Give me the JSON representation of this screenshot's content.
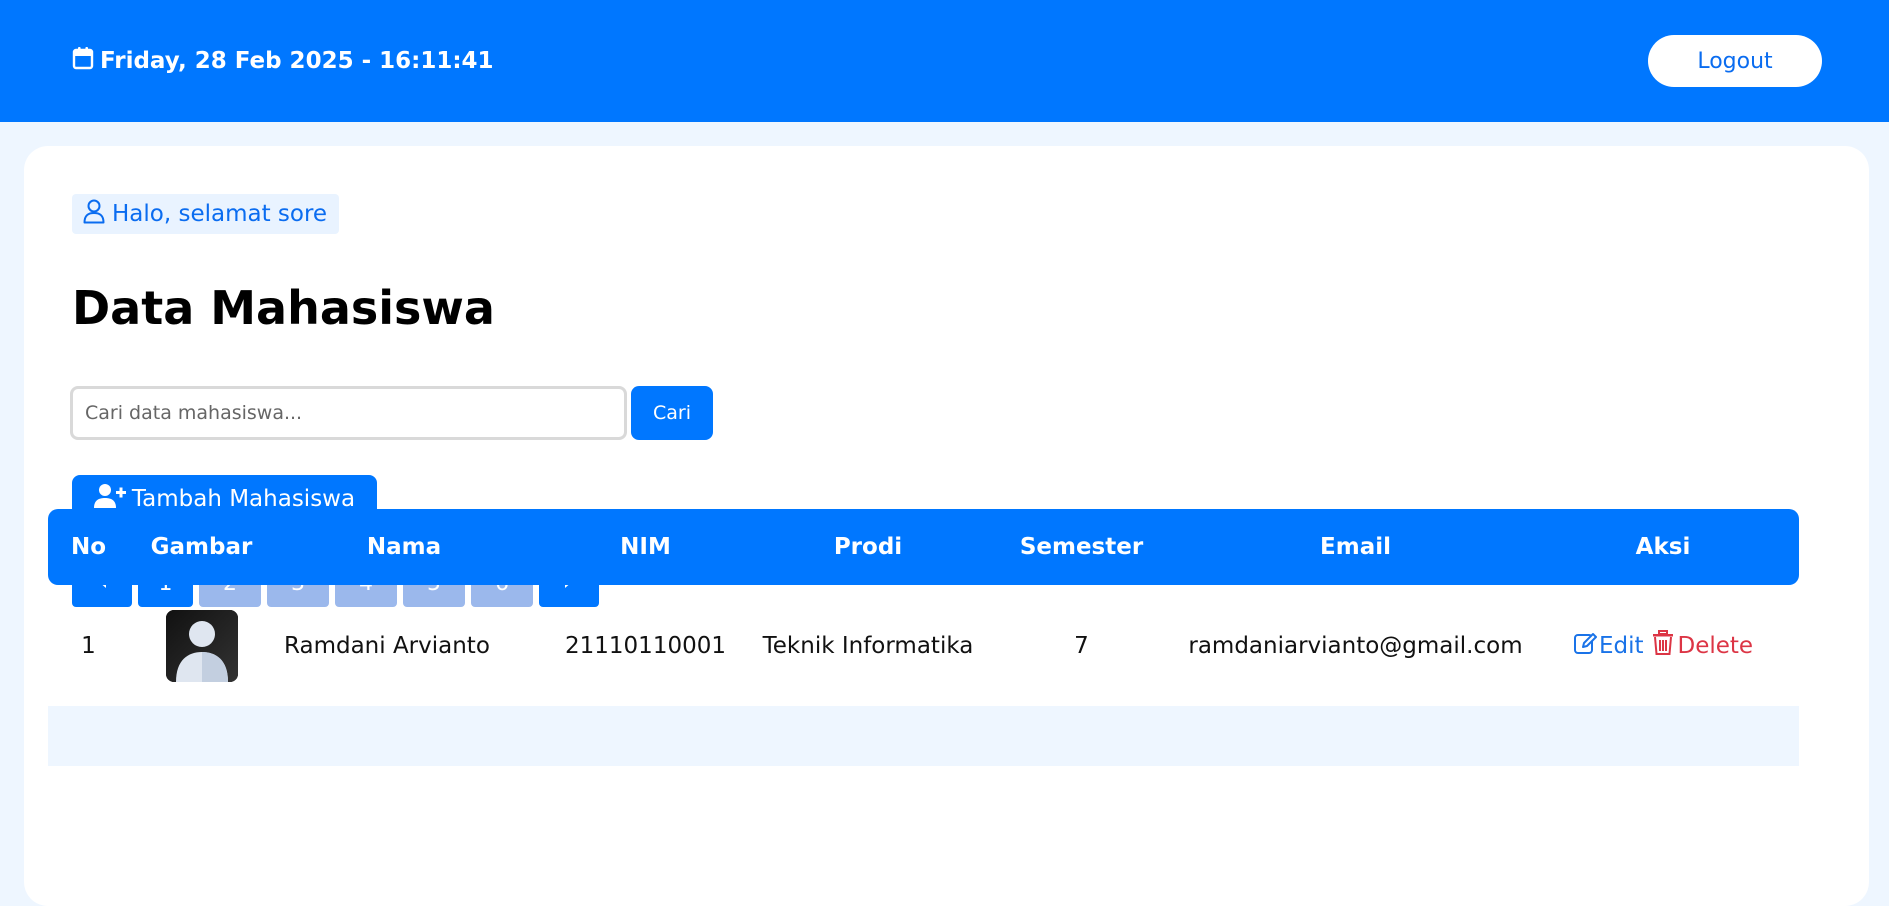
{
  "header": {
    "datetime": "Friday, 28 Feb 2025 - 16:11:41",
    "logout_label": "Logout"
  },
  "greeting": "Halo, selamat sore",
  "page_title": "Data Mahasiswa",
  "search": {
    "placeholder": "Cari data mahasiswa...",
    "button_label": "Cari"
  },
  "add_button_label": "Tambah Mahasiswa",
  "pagination": {
    "pages": [
      "1",
      "2",
      "3",
      "4",
      "5",
      "6"
    ],
    "current": "1"
  },
  "table": {
    "columns": [
      "No",
      "Gambar",
      "Nama",
      "NIM",
      "Prodi",
      "Semester",
      "Email",
      "Aksi"
    ],
    "rows": [
      {
        "no": "1",
        "nama": "Ramdani Arvianto",
        "nim": "21110110001",
        "prodi": "Teknik Informatika",
        "semester": "7",
        "email": "ramdaniarvianto@gmail.com",
        "edit_label": "Edit",
        "delete_label": "Delete"
      }
    ]
  },
  "colors": {
    "primary": "#0077ff",
    "page_inactive": "#9bb8ec",
    "delete": "#dc3545",
    "background": "#eef6ff"
  },
  "icons": [
    "calendar-icon",
    "user-icon",
    "user-plus-icon",
    "caret-left-icon",
    "caret-right-icon",
    "edit-icon",
    "trash-icon"
  ]
}
